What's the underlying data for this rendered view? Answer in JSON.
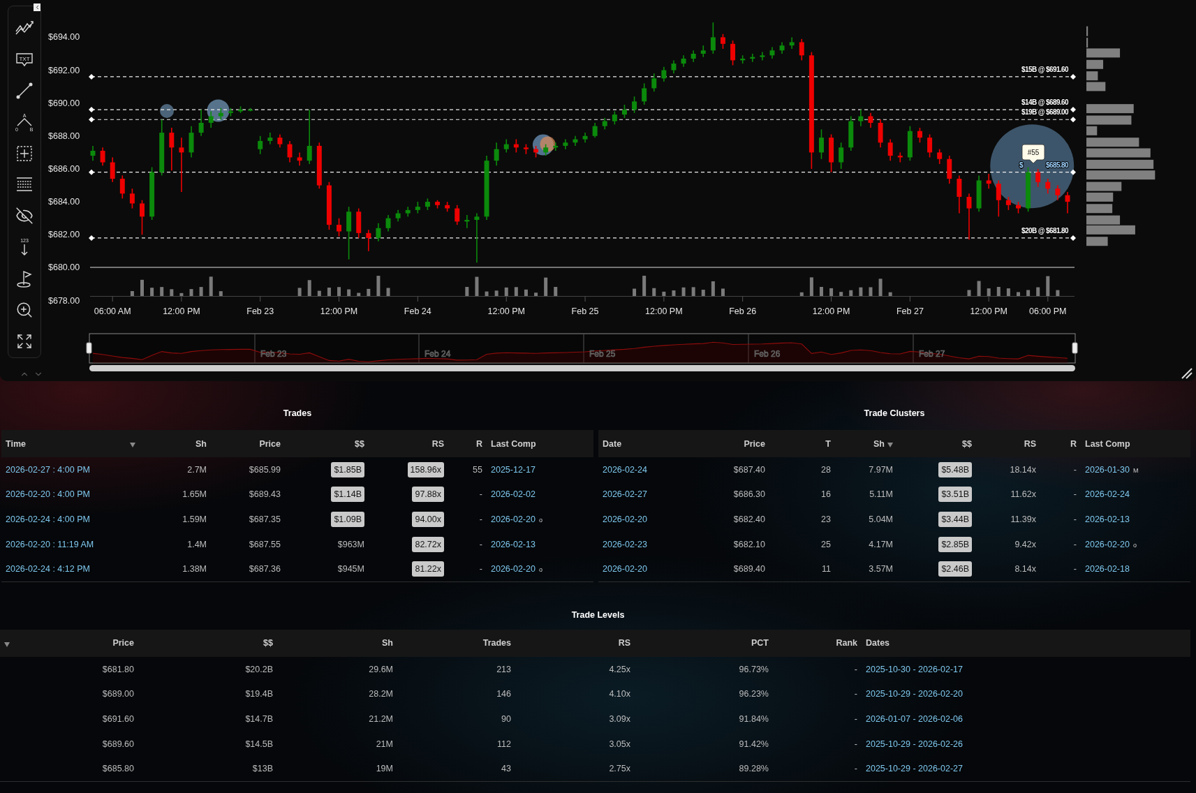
{
  "chart": {
    "toolbar": [
      {
        "kind": "trend"
      },
      {
        "kind": "text",
        "label": "TXT"
      },
      {
        "kind": "line"
      },
      {
        "kind": "pattern",
        "labels": [
          "A",
          "0",
          "B"
        ]
      },
      {
        "kind": "crosshair"
      },
      {
        "kind": "grid"
      },
      {
        "kind": "hide"
      },
      {
        "kind": "count",
        "label": "123"
      },
      {
        "kind": "flag"
      },
      {
        "kind": "zoom"
      },
      {
        "kind": "fit"
      }
    ],
    "chart_data": {
      "type": "candlestick",
      "ylim": [
        678,
        694
      ],
      "ref_lines": [
        {
          "axis": "y",
          "value": 691.6
        },
        {
          "axis": "y",
          "value": 689.6
        },
        {
          "axis": "y",
          "value": 689.0
        },
        {
          "axis": "y",
          "value": 685.8
        },
        {
          "axis": "y",
          "value": 681.8
        }
      ],
      "yticks": [
        {
          "value": 694,
          "label": "$694.00"
        },
        {
          "value": 692,
          "label": "$692.00"
        },
        {
          "value": 690,
          "label": "$690.00"
        },
        {
          "value": 688,
          "label": "$688.00"
        },
        {
          "value": 686,
          "label": "$686.00"
        },
        {
          "value": 684,
          "label": "$684.00"
        },
        {
          "value": 682,
          "label": "$682.00"
        },
        {
          "value": 680,
          "label": "$680.00"
        },
        {
          "value": 678,
          "label": "$678.00"
        }
      ],
      "categories": [
        null,
        null,
        "06:00 AM",
        null,
        null,
        null,
        null,
        null,
        null,
        "12:00 PM",
        null,
        null,
        null,
        null,
        null,
        null,
        null,
        "Feb 23",
        null,
        null,
        null,
        null,
        null,
        null,
        null,
        "12:00 PM",
        null,
        null,
        null,
        null,
        null,
        null,
        null,
        "Feb 24",
        null,
        null,
        null,
        null,
        null,
        null,
        null,
        null,
        "12:00 PM",
        null,
        null,
        null,
        null,
        null,
        null,
        null,
        "Feb 25",
        null,
        null,
        null,
        null,
        null,
        null,
        null,
        "12:00 PM",
        null,
        null,
        null,
        null,
        null,
        null,
        null,
        "Feb 26",
        null,
        null,
        null,
        null,
        null,
        null,
        null,
        null,
        "12:00 PM",
        null,
        null,
        null,
        null,
        null,
        null,
        null,
        "Feb 27",
        null,
        null,
        null,
        null,
        null,
        null,
        null,
        "12:00 PM",
        null,
        null,
        null,
        null,
        null,
        "06:00 PM",
        null,
        null
      ],
      "ohlc": [
        [
          686.8,
          687.4,
          686.5,
          687.1
        ],
        [
          687.1,
          687.3,
          686.2,
          686.4
        ],
        [
          686.4,
          686.7,
          685.2,
          685.4
        ],
        [
          685.4,
          685.6,
          684.2,
          684.5
        ],
        [
          684.5,
          684.8,
          683.6,
          683.9
        ],
        [
          683.9,
          684.1,
          682.0,
          683.1
        ],
        [
          683.1,
          686.1,
          682.9,
          685.8
        ],
        [
          685.8,
          689.0,
          685.6,
          688.2
        ],
        [
          688.2,
          688.5,
          685.9,
          687.3
        ],
        [
          687.3,
          687.9,
          684.6,
          687.0
        ],
        [
          687.0,
          688.6,
          686.7,
          688.2
        ],
        [
          688.2,
          689.6,
          688.0,
          688.8
        ],
        [
          688.8,
          689.5,
          688.5,
          689.2
        ],
        [
          689.2,
          689.7,
          689.0,
          689.4
        ],
        [
          689.4,
          689.7,
          689.2,
          689.5
        ],
        [
          689.5,
          689.8,
          689.4,
          689.6
        ],
        [
          689.6,
          689.7,
          689.5,
          689.6
        ],
        [
          687.2,
          688.0,
          686.9,
          687.7
        ],
        [
          687.7,
          688.2,
          687.5,
          687.9
        ],
        [
          687.9,
          688.1,
          687.3,
          687.5
        ],
        [
          687.5,
          687.7,
          686.4,
          686.7
        ],
        [
          686.7,
          687.0,
          686.2,
          686.5
        ],
        [
          686.5,
          689.6,
          686.3,
          687.4
        ],
        [
          687.4,
          687.6,
          684.8,
          685.0
        ],
        [
          685.0,
          685.2,
          682.3,
          682.6
        ],
        [
          682.6,
          683.0,
          681.9,
          682.2
        ],
        [
          682.2,
          683.7,
          680.5,
          683.4
        ],
        [
          683.4,
          683.6,
          681.8,
          682.1
        ],
        [
          682.1,
          682.3,
          681.0,
          681.8
        ],
        [
          681.8,
          682.7,
          681.6,
          682.4
        ],
        [
          682.4,
          683.2,
          682.2,
          683.0
        ],
        [
          683.0,
          683.5,
          682.8,
          683.3
        ],
        [
          683.3,
          683.7,
          683.1,
          683.5
        ],
        [
          683.5,
          684.0,
          683.3,
          683.7
        ],
        [
          683.7,
          684.2,
          683.5,
          684.0
        ],
        [
          684.0,
          684.1,
          683.6,
          683.8
        ],
        [
          683.8,
          684.0,
          683.4,
          683.6
        ],
        [
          683.6,
          683.8,
          682.6,
          682.8
        ],
        [
          682.8,
          683.2,
          682.4,
          682.9
        ],
        [
          682.9,
          683.3,
          680.3,
          683.1
        ],
        [
          683.1,
          686.8,
          682.9,
          686.5
        ],
        [
          686.5,
          687.6,
          686.2,
          687.2
        ],
        [
          687.2,
          687.8,
          687.0,
          687.5
        ],
        [
          687.5,
          687.8,
          687.0,
          687.3
        ],
        [
          687.3,
          687.5,
          686.9,
          687.2
        ],
        [
          687.2,
          687.4,
          686.7,
          687.0
        ],
        [
          687.0,
          687.5,
          686.8,
          687.3
        ],
        [
          687.3,
          687.6,
          687.1,
          687.4
        ],
        [
          687.4,
          687.8,
          687.2,
          687.6
        ],
        [
          687.6,
          688.0,
          687.4,
          687.8
        ],
        [
          687.8,
          688.2,
          687.6,
          688.0
        ],
        [
          688.0,
          688.8,
          687.9,
          688.6
        ],
        [
          688.6,
          689.1,
          688.4,
          688.9
        ],
        [
          688.9,
          689.5,
          688.7,
          689.3
        ],
        [
          689.3,
          689.9,
          689.1,
          689.6
        ],
        [
          689.6,
          690.4,
          689.4,
          690.1
        ],
        [
          690.1,
          691.2,
          689.9,
          690.9
        ],
        [
          690.9,
          691.8,
          690.7,
          691.5
        ],
        [
          691.5,
          692.2,
          691.3,
          692.0
        ],
        [
          692.0,
          692.6,
          691.8,
          692.4
        ],
        [
          692.4,
          692.9,
          692.2,
          692.7
        ],
        [
          692.7,
          693.2,
          692.5,
          693.0
        ],
        [
          693.0,
          693.5,
          692.8,
          693.2
        ],
        [
          693.2,
          694.9,
          693.0,
          694.0
        ],
        [
          694.0,
          694.2,
          693.3,
          693.6
        ],
        [
          693.6,
          693.8,
          692.3,
          692.6
        ],
        [
          692.6,
          692.9,
          692.4,
          692.7
        ],
        [
          692.7,
          693.0,
          692.5,
          692.8
        ],
        [
          692.8,
          693.1,
          692.6,
          692.9
        ],
        [
          692.9,
          693.4,
          692.7,
          693.2
        ],
        [
          693.2,
          693.7,
          693.0,
          693.5
        ],
        [
          693.5,
          694.0,
          693.3,
          693.7
        ],
        [
          693.7,
          693.9,
          692.6,
          692.9
        ],
        [
          692.9,
          693.1,
          686.0,
          687.0
        ],
        [
          687.0,
          688.4,
          686.6,
          687.9
        ],
        [
          687.9,
          688.1,
          685.8,
          686.4
        ],
        [
          686.4,
          687.6,
          686.0,
          687.3
        ],
        [
          687.3,
          689.2,
          687.1,
          688.9
        ],
        [
          688.9,
          689.6,
          688.6,
          689.2
        ],
        [
          689.2,
          689.4,
          688.5,
          688.8
        ],
        [
          688.8,
          689.0,
          687.3,
          687.6
        ],
        [
          687.6,
          687.8,
          686.5,
          686.8
        ],
        [
          686.8,
          687.0,
          686.4,
          686.7
        ],
        [
          686.7,
          688.6,
          686.5,
          688.3
        ],
        [
          688.3,
          688.5,
          687.6,
          687.9
        ],
        [
          687.9,
          688.1,
          686.7,
          687.0
        ],
        [
          687.0,
          687.2,
          686.3,
          686.6
        ],
        [
          686.6,
          686.8,
          685.1,
          685.4
        ],
        [
          685.4,
          685.6,
          683.3,
          684.3
        ],
        [
          684.3,
          684.5,
          681.7,
          683.6
        ],
        [
          683.6,
          685.6,
          683.4,
          685.3
        ],
        [
          685.3,
          685.7,
          684.8,
          685.1
        ],
        [
          685.1,
          685.3,
          683.1,
          684.1
        ],
        [
          684.1,
          684.3,
          683.5,
          683.8
        ],
        [
          683.8,
          684.0,
          683.3,
          683.6
        ],
        [
          683.6,
          686.1,
          683.4,
          685.8
        ],
        [
          685.8,
          686.0,
          684.9,
          685.2
        ],
        [
          685.2,
          685.4,
          684.5,
          684.8
        ],
        [
          684.8,
          685.0,
          684.1,
          684.4
        ],
        [
          684.4,
          684.6,
          683.3,
          684.0
        ]
      ]
    },
    "levels": [
      {
        "label": "$15B @ $691.60",
        "highlighted": false
      },
      {
        "label": "$14B @ $689.60",
        "highlighted": false
      },
      {
        "label": "$19B @ $689.00",
        "highlighted": false
      },
      {
        "label": "$685.80",
        "prefix": "$",
        "highlighted": true
      },
      {
        "label": "$20B @ $681.80",
        "highlighted": false
      }
    ],
    "tooltip": "#55",
    "navigator": [
      "Feb 23",
      "Feb 24",
      "Feb 25",
      "Feb 26",
      "Feb 27"
    ]
  },
  "trades": {
    "title": "Trades",
    "columns": [
      {
        "label": "Time",
        "sorted": true
      },
      {
        "label": "Sh",
        "sorted": false
      },
      {
        "label": "Price",
        "sorted": false
      },
      {
        "label": "$$",
        "sorted": false
      },
      {
        "label": "RS",
        "sorted": false
      },
      {
        "label": "R",
        "sorted": false
      },
      {
        "label": "Last Comp",
        "sorted": false
      }
    ],
    "rows": [
      {
        "cells": [
          {
            "kind": "link",
            "text": "2026-02-27 : 4:00 PM"
          },
          {
            "kind": "value",
            "text": "2.7M"
          },
          {
            "kind": "value",
            "text": "$685.99"
          },
          {
            "kind": "badge",
            "text": "$1.85B"
          },
          {
            "kind": "badge",
            "text": "158.96x"
          },
          {
            "kind": "value",
            "text": "55"
          },
          {
            "kind": "link",
            "text": "2025-12-17"
          }
        ]
      },
      {
        "cells": [
          {
            "kind": "link",
            "text": "2026-02-20 : 4:00 PM"
          },
          {
            "kind": "value",
            "text": "1.65M"
          },
          {
            "kind": "value",
            "text": "$689.43"
          },
          {
            "kind": "badge",
            "text": "$1.14B"
          },
          {
            "kind": "badge",
            "text": "97.88x"
          },
          {
            "kind": "value",
            "text": "-"
          },
          {
            "kind": "link",
            "text": "2026-02-02"
          }
        ]
      },
      {
        "cells": [
          {
            "kind": "link",
            "text": "2026-02-24 : 4:00 PM"
          },
          {
            "kind": "value",
            "text": "1.59M"
          },
          {
            "kind": "value",
            "text": "$687.35"
          },
          {
            "kind": "badge",
            "text": "$1.09B"
          },
          {
            "kind": "badge",
            "text": "94.00x"
          },
          {
            "kind": "value",
            "text": "-"
          },
          {
            "kind": "link",
            "text": "2026-02-20",
            "note": "o"
          }
        ]
      },
      {
        "cells": [
          {
            "kind": "link",
            "text": "2026-02-20 : 11:19 AM"
          },
          {
            "kind": "value",
            "text": "1.4M"
          },
          {
            "kind": "value",
            "text": "$687.55"
          },
          {
            "kind": "value",
            "text": "$963M"
          },
          {
            "kind": "badge",
            "text": "82.72x"
          },
          {
            "kind": "value",
            "text": "-"
          },
          {
            "kind": "link",
            "text": "2026-02-13"
          }
        ]
      },
      {
        "cells": [
          {
            "kind": "link",
            "text": "2026-02-24 : 4:12 PM"
          },
          {
            "kind": "value",
            "text": "1.38M"
          },
          {
            "kind": "value",
            "text": "$687.36"
          },
          {
            "kind": "value",
            "text": "$945M"
          },
          {
            "kind": "badge",
            "text": "81.22x"
          },
          {
            "kind": "value",
            "text": "-"
          },
          {
            "kind": "link",
            "text": "2026-02-20",
            "note": "o"
          }
        ]
      }
    ]
  },
  "clusters": {
    "title": "Trade Clusters",
    "columns": [
      {
        "label": "Date",
        "sorted": false
      },
      {
        "label": "Price",
        "sorted": false
      },
      {
        "label": "T",
        "sorted": false
      },
      {
        "label": "Sh",
        "sorted": true
      },
      {
        "label": "$$",
        "sorted": false
      },
      {
        "label": "RS",
        "sorted": false
      },
      {
        "label": "R",
        "sorted": false
      },
      {
        "label": "Last Comp",
        "sorted": false
      }
    ],
    "rows": [
      {
        "cells": [
          {
            "kind": "link",
            "text": "2026-02-24"
          },
          {
            "kind": "value",
            "text": "$687.40"
          },
          {
            "kind": "value",
            "text": "28"
          },
          {
            "kind": "value",
            "text": "7.97M"
          },
          {
            "kind": "badge",
            "text": "$5.48B"
          },
          {
            "kind": "value",
            "text": "18.14x"
          },
          {
            "kind": "value",
            "text": "-"
          },
          {
            "kind": "link",
            "text": "2026-01-30",
            "note": "M"
          }
        ]
      },
      {
        "cells": [
          {
            "kind": "link",
            "text": "2026-02-27"
          },
          {
            "kind": "value",
            "text": "$686.30"
          },
          {
            "kind": "value",
            "text": "16"
          },
          {
            "kind": "value",
            "text": "5.11M"
          },
          {
            "kind": "badge",
            "text": "$3.51B"
          },
          {
            "kind": "value",
            "text": "11.62x"
          },
          {
            "kind": "value",
            "text": "-"
          },
          {
            "kind": "link",
            "text": "2026-02-24"
          }
        ]
      },
      {
        "cells": [
          {
            "kind": "link",
            "text": "2026-02-20"
          },
          {
            "kind": "value",
            "text": "$682.40"
          },
          {
            "kind": "value",
            "text": "23"
          },
          {
            "kind": "value",
            "text": "5.04M"
          },
          {
            "kind": "badge",
            "text": "$3.44B"
          },
          {
            "kind": "value",
            "text": "11.39x"
          },
          {
            "kind": "value",
            "text": "-"
          },
          {
            "kind": "link",
            "text": "2026-02-13"
          }
        ]
      },
      {
        "cells": [
          {
            "kind": "link",
            "text": "2026-02-23"
          },
          {
            "kind": "value",
            "text": "$682.10"
          },
          {
            "kind": "value",
            "text": "25"
          },
          {
            "kind": "value",
            "text": "4.17M"
          },
          {
            "kind": "badge",
            "text": "$2.85B"
          },
          {
            "kind": "value",
            "text": "9.42x"
          },
          {
            "kind": "value",
            "text": "-"
          },
          {
            "kind": "link",
            "text": "2026-02-20",
            "note": "o"
          }
        ]
      },
      {
        "cells": [
          {
            "kind": "link",
            "text": "2026-02-20"
          },
          {
            "kind": "value",
            "text": "$689.40"
          },
          {
            "kind": "value",
            "text": "11"
          },
          {
            "kind": "value",
            "text": "3.57M"
          },
          {
            "kind": "badge",
            "text": "$2.46B"
          },
          {
            "kind": "value",
            "text": "8.14x"
          },
          {
            "kind": "value",
            "text": "-"
          },
          {
            "kind": "link",
            "text": "2026-02-18"
          }
        ]
      }
    ]
  },
  "levels": {
    "title": "Trade Levels",
    "columns": [
      {
        "sorted": true
      },
      {
        "label": "Price",
        "sorted": false
      },
      {
        "label": "$$",
        "sorted": false
      },
      {
        "label": "Sh",
        "sorted": false
      },
      {
        "label": "Trades",
        "sorted": false
      },
      {
        "label": "RS",
        "sorted": false
      },
      {
        "label": "PCT",
        "sorted": false
      },
      {
        "label": "Rank",
        "sorted": false
      },
      {
        "label": "Dates",
        "sorted": false
      }
    ],
    "rows": [
      {
        "cells": [
          {
            "kind": "empty"
          },
          {
            "kind": "value",
            "text": "$681.80"
          },
          {
            "kind": "value",
            "text": "$20.2B"
          },
          {
            "kind": "value",
            "text": "29.6M"
          },
          {
            "kind": "value",
            "text": "213"
          },
          {
            "kind": "value",
            "text": "4.25x"
          },
          {
            "kind": "value",
            "text": "96.73%"
          },
          {
            "kind": "value",
            "text": "-"
          },
          {
            "kind": "link",
            "text": "2025-10-30 - 2026-02-17"
          }
        ]
      },
      {
        "cells": [
          {
            "kind": "empty"
          },
          {
            "kind": "value",
            "text": "$689.00"
          },
          {
            "kind": "value",
            "text": "$19.4B"
          },
          {
            "kind": "value",
            "text": "28.2M"
          },
          {
            "kind": "value",
            "text": "146"
          },
          {
            "kind": "value",
            "text": "4.10x"
          },
          {
            "kind": "value",
            "text": "96.23%"
          },
          {
            "kind": "value",
            "text": "-"
          },
          {
            "kind": "link",
            "text": "2025-10-29 - 2026-02-20"
          }
        ]
      },
      {
        "cells": [
          {
            "kind": "empty"
          },
          {
            "kind": "value",
            "text": "$691.60"
          },
          {
            "kind": "value",
            "text": "$14.7B"
          },
          {
            "kind": "value",
            "text": "21.2M"
          },
          {
            "kind": "value",
            "text": "90"
          },
          {
            "kind": "value",
            "text": "3.09x"
          },
          {
            "kind": "value",
            "text": "91.84%"
          },
          {
            "kind": "value",
            "text": "-"
          },
          {
            "kind": "link",
            "text": "2026-01-07 - 2026-02-06"
          }
        ]
      },
      {
        "cells": [
          {
            "kind": "empty"
          },
          {
            "kind": "value",
            "text": "$689.60"
          },
          {
            "kind": "value",
            "text": "$14.5B"
          },
          {
            "kind": "value",
            "text": "21M"
          },
          {
            "kind": "value",
            "text": "112"
          },
          {
            "kind": "value",
            "text": "3.05x"
          },
          {
            "kind": "value",
            "text": "91.42%"
          },
          {
            "kind": "value",
            "text": "-"
          },
          {
            "kind": "link",
            "text": "2025-10-29 - 2026-02-26"
          }
        ]
      },
      {
        "cells": [
          {
            "kind": "empty"
          },
          {
            "kind": "value",
            "text": "$685.80"
          },
          {
            "kind": "value",
            "text": "$13B"
          },
          {
            "kind": "value",
            "text": "19M"
          },
          {
            "kind": "value",
            "text": "43"
          },
          {
            "kind": "value",
            "text": "2.75x"
          },
          {
            "kind": "value",
            "text": "89.28%"
          },
          {
            "kind": "value",
            "text": "-"
          },
          {
            "kind": "link",
            "text": "2025-10-29 - 2026-02-27"
          }
        ]
      }
    ]
  }
}
